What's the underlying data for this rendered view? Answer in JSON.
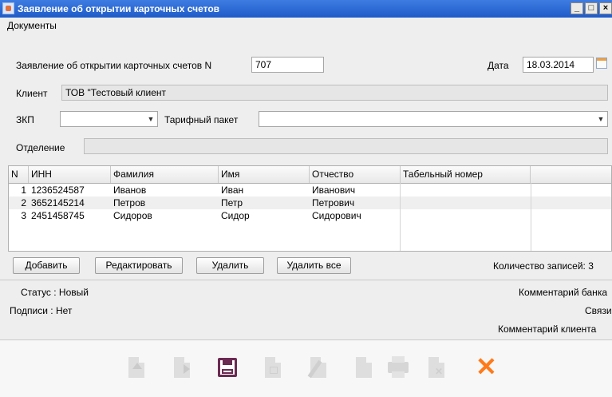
{
  "window": {
    "title": "Заявление об открытии карточных счетов",
    "controls": [
      "_",
      "□",
      "×"
    ]
  },
  "menu": {
    "items": [
      "Документы"
    ]
  },
  "form": {
    "statement_label": "Заявление об открытии карточных счетов N",
    "statement_number": "707",
    "date_label": "Дата",
    "date_value": "18.03.2014",
    "client_label": "Клиент",
    "client_value": "ТОВ \"Тестовый клиент",
    "zkp_label": "ЗКП",
    "zkp_value": "",
    "tariff_label": "Тарифный пакет",
    "tariff_value": "",
    "branch_label": "Отделение",
    "branch_value": ""
  },
  "table": {
    "columns": [
      "N",
      "ИНН",
      "Фамилия",
      "Имя",
      "Отчество",
      "Табельный номер"
    ],
    "rows": [
      [
        "1",
        "1236524587",
        "Иванов",
        "Иван",
        "Иванович",
        ""
      ],
      [
        "2",
        "3652145214",
        "Петров",
        "Петр",
        "Петрович",
        ""
      ],
      [
        "3",
        "2451458745",
        "Сидоров",
        "Сидор",
        "Сидорович",
        ""
      ]
    ]
  },
  "buttons": {
    "add": "Добавить",
    "edit": "Редактировать",
    "delete": "Удалить",
    "delete_all": "Удалить все"
  },
  "records_count_label": "Количество записей: 3",
  "status": {
    "status_text": "Статус : Новый",
    "signatures_text": "Подписи : Нет",
    "bank_comment": "Комментарий банка",
    "links": "Связи",
    "client_comment": "Комментарий клиента"
  },
  "toolbar": {
    "icons": [
      "import-icon",
      "export-icon",
      "save-icon",
      "report-icon",
      "sign-icon",
      "copy-icon",
      "print-icon",
      "delete-doc-icon",
      "close-icon"
    ],
    "accent_save": "#6b2a52",
    "accent_close": "#ff7a1a"
  }
}
